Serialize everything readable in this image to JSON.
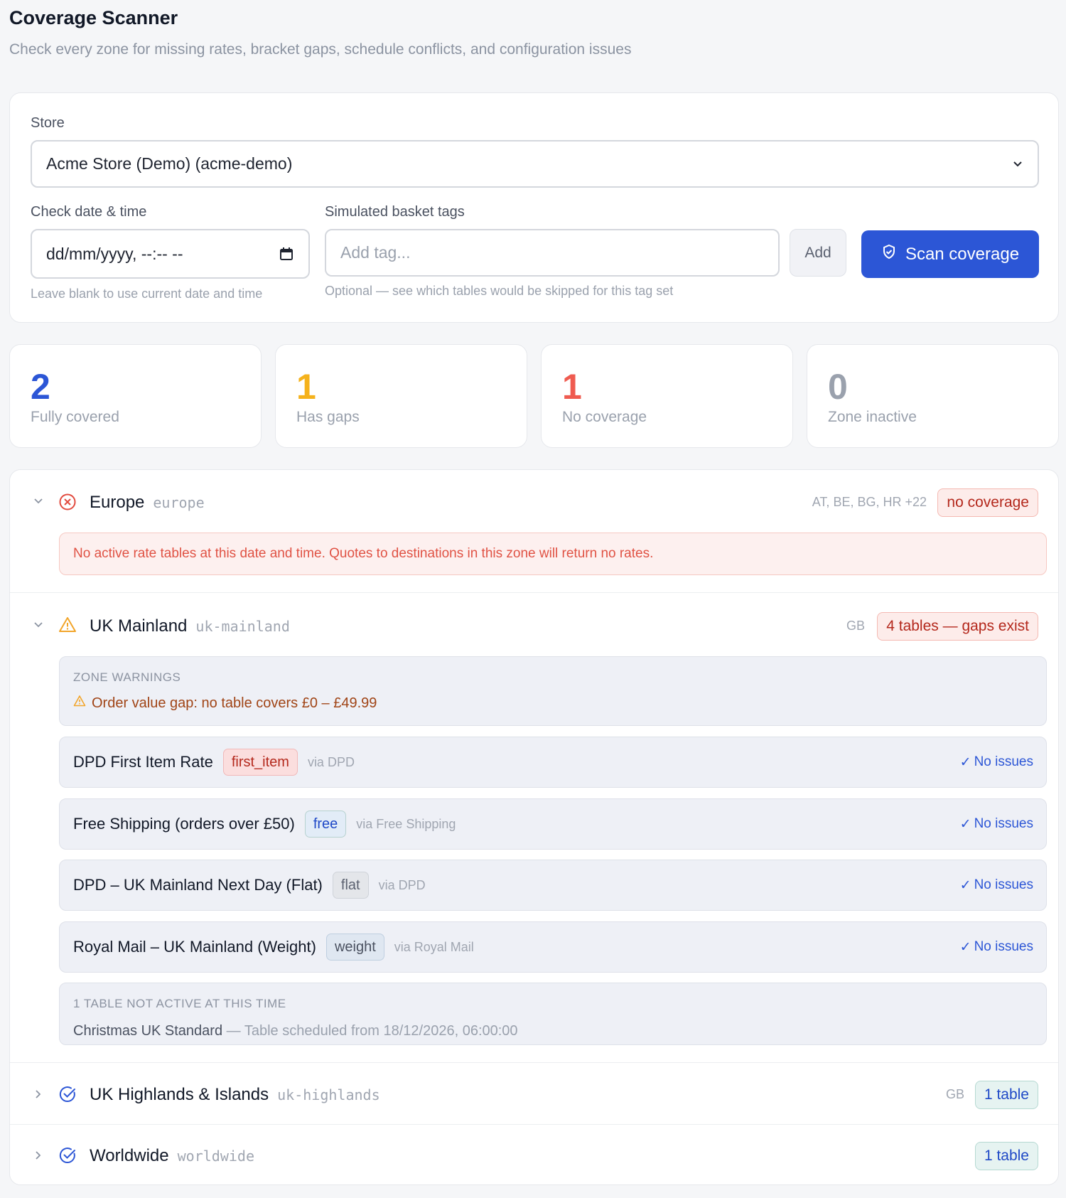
{
  "page": {
    "title": "Coverage Scanner",
    "subtitle": "Check every zone for missing rates, bracket gaps, schedule conflicts, and configuration issues"
  },
  "controls": {
    "store_label": "Store",
    "store_value": "Acme Store (Demo) (acme-demo)",
    "date_label": "Check date & time",
    "date_value": "dd/mm/yyyy, --:-- --",
    "date_hint": "Leave blank to use current date and time",
    "tags_label": "Simulated basket tags",
    "tags_placeholder": "Add tag...",
    "tags_hint": "Optional — see which tables would be skipped for this tag set",
    "add_label": "Add",
    "scan_label": "Scan coverage"
  },
  "stats": [
    {
      "value": "2",
      "label": "Fully covered",
      "color": "#2c56d6"
    },
    {
      "value": "1",
      "label": "Has gaps",
      "color": "#f5b21c"
    },
    {
      "value": "1",
      "label": "No coverage",
      "color": "#ef5b50"
    },
    {
      "value": "0",
      "label": "Zone inactive",
      "color": "#9aa1ad"
    }
  ],
  "zones": {
    "europe": {
      "name": "Europe",
      "slug": "europe",
      "countries": "AT, BE, BG, HR +22",
      "badge": "no coverage",
      "alert": "No active rate tables at this date and time. Quotes to destinations in this zone will return no rates."
    },
    "uk_mainland": {
      "name": "UK Mainland",
      "slug": "uk-mainland",
      "countries": "GB",
      "badge": "4 tables — gaps exist",
      "warnings_caption": "ZONE WARNINGS",
      "warning": "Order value gap: no table covers £0 – £49.99",
      "tables": [
        {
          "name": "DPD First Item Rate",
          "type": "first_item",
          "via": "via DPD",
          "status": "No issues"
        },
        {
          "name": "Free Shipping (orders over £50)",
          "type": "free",
          "via": "via Free Shipping",
          "status": "No issues"
        },
        {
          "name": "DPD – UK Mainland Next Day (Flat)",
          "type": "flat",
          "via": "via DPD",
          "status": "No issues"
        },
        {
          "name": "Royal Mail – UK Mainland (Weight)",
          "type": "weight",
          "via": "via Royal Mail",
          "status": "No issues"
        }
      ],
      "inactive_caption": "1 TABLE NOT ACTIVE AT THIS TIME",
      "inactive_name": "Christmas UK Standard",
      "inactive_detail": " — Table scheduled from 18/12/2026, 06:00:00"
    },
    "uk_highlands": {
      "name": "UK Highlands & Islands",
      "slug": "uk-highlands",
      "countries": "GB",
      "badge": "1 table"
    },
    "worldwide": {
      "name": "Worldwide",
      "slug": "worldwide",
      "badge": "1 table"
    }
  }
}
